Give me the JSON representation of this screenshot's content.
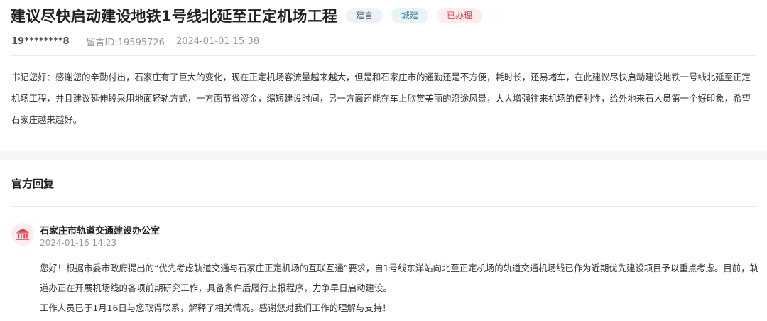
{
  "post": {
    "title": "建议尽快启动建设地铁1号线北延至正定机场工程",
    "tags": {
      "type": "建言",
      "category": "城建",
      "status": "已办理"
    },
    "user": "19********8",
    "message_id": "留言ID:19595726",
    "datetime": "2024-01-01 15:38",
    "content": "书记您好：感谢您的辛勤付出，石家庄有了巨大的变化，现在正定机场客流量越来越大，但是和石家庄市的通勤还是不方便，耗时长，还易堵车，在此建议尽快启动建设地铁一号线北延至正定机场工程，并且建议延伸段采用地面轻轨方式，一方面节省资金，缩短建设时间，另一方面还能在车上欣赏美丽的沿途风景，大大增强往来机场的便利性，给外地来石人员第一个好印象，希望石家庄越来越好。"
  },
  "reply": {
    "section_title": "官方回复",
    "office_icon": "government-building-icon",
    "office_name": "石家庄市轨道交通建设办公室",
    "datetime": "2024-01-16 14:23",
    "paragraph1": "您好！根据市委市政府提出的“优先考虑轨道交通与石家庄正定机场的互联互通”要求，自1号线东洋站向北至正定机场的轨道交通机场线已作为近期优先建设项目予以重点考虑。目前，轨道办正在开展机场线的各项前期研究工作，具备条件后履行上报程序，力争早日启动建设。",
    "paragraph2": "工作人员已于1月16日与您取得联系，解释了相关情况。感谢您对我们工作的理解与支持！"
  },
  "colors": {
    "status_red": "#e04454",
    "icon_bg": "#fdecee",
    "page_gap": "#f5f6f8"
  }
}
